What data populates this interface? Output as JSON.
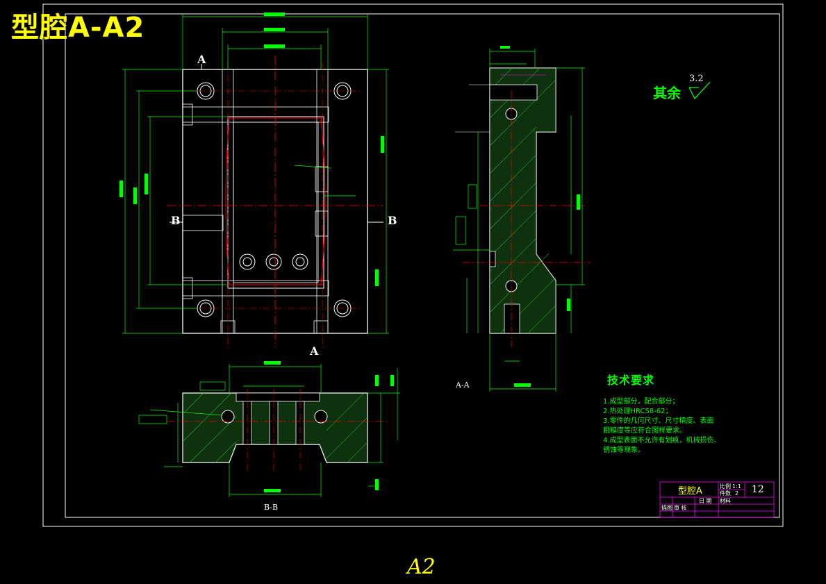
{
  "drawing": {
    "overlay_title": "型腔A-A2",
    "sheet_size": "A2",
    "roughness_label": "其余",
    "roughness_value": "3.2"
  },
  "views": {
    "section_aa_label": "A-A",
    "section_bb_label": "B-B",
    "cut_A_top": "A",
    "cut_A_bottom": "A",
    "cut_B_left": "B",
    "cut_B_right": "B"
  },
  "technical_requirements": {
    "title": "技术要求",
    "items": [
      "1.成型部分，配合部分；",
      "2.热处理HRC58-62；",
      "3.零件的几何尺寸、尺寸精度、表面",
      "   粗糙度等应符合图样要求。",
      "4.成型表面不允许有划痕，机械损伤、",
      "   锈蚀等现象。"
    ]
  },
  "title_block": {
    "part_name": "型腔A",
    "scale_label": "比例",
    "scale_value": "1:1",
    "quantity_label": "件数",
    "quantity_value": "2",
    "drawing_number": "12",
    "date_label": "日 期",
    "material_label": "材料",
    "row3_left": "描图",
    "row3_mid": "审 核"
  },
  "colors": {
    "background": "#000000",
    "outline": "#ffffff",
    "dimension": "#00ff00",
    "centerline": "#ff0000",
    "title_yellow": "#ffff00",
    "title_block": "#ff00ff"
  }
}
